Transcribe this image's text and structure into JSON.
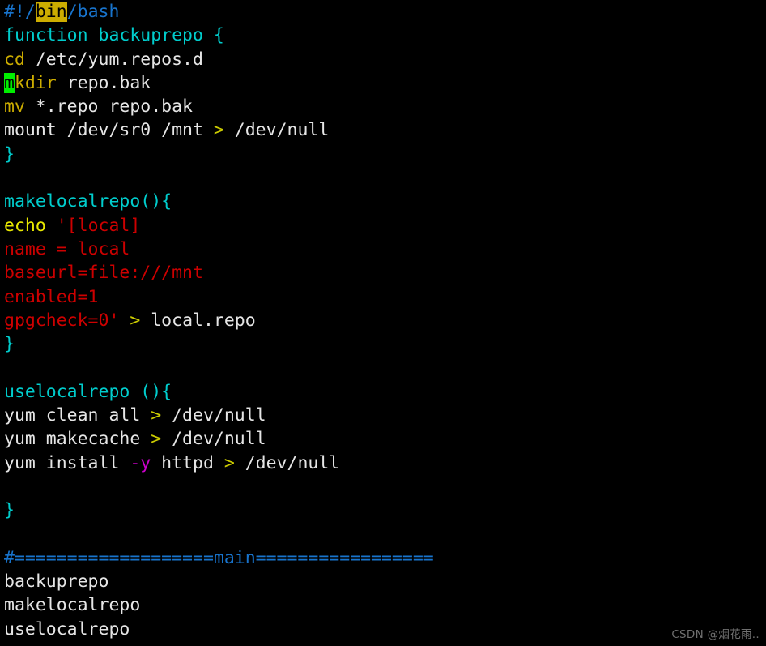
{
  "editor": {
    "background_color": "#000000",
    "default_text_color": "#d9d9d9",
    "font_size_px": 21.5,
    "line_height_px": 29.3,
    "search_highlight_color": "#cdad00",
    "cursor_color": "#00ee00",
    "palette": {
      "comment_blue": "#1874cd",
      "keyword_cyan": "#00cdcd",
      "command_olive": "#cdad00",
      "echo_yellow": "#e8e800",
      "redirect_gold": "#cdcd00",
      "string_red": "#cd0000",
      "flag_magenta": "#cd00cd",
      "plain_white": "#e6e6e6"
    },
    "lines": [
      {
        "id": "line-1",
        "text": "#!/bin/bash",
        "tokens": [
          {
            "t": "#!/",
            "c": "c-blue"
          },
          {
            "t": "bin",
            "c": "c-blue",
            "hl": "search"
          },
          {
            "t": "/bash",
            "c": "c-blue"
          }
        ]
      },
      {
        "id": "line-2",
        "text": "function backuprepo {",
        "tokens": [
          {
            "t": "function backuprepo {",
            "c": "c-cyan"
          }
        ]
      },
      {
        "id": "line-3",
        "text": "cd /etc/yum.repos.d",
        "tokens": [
          {
            "t": "cd",
            "c": "c-olive"
          },
          {
            "t": " /etc/yum.repos.d",
            "c": "c-white"
          }
        ]
      },
      {
        "id": "line-4",
        "text": "mkdir repo.bak",
        "tokens": [
          {
            "t": "m",
            "c": "c-olive",
            "hl": "cursor"
          },
          {
            "t": "kdir",
            "c": "c-olive"
          },
          {
            "t": " repo.bak",
            "c": "c-white"
          }
        ]
      },
      {
        "id": "line-5",
        "text": "mv *.repo repo.bak",
        "tokens": [
          {
            "t": "mv",
            "c": "c-olive"
          },
          {
            "t": " *.repo repo.bak",
            "c": "c-white"
          }
        ]
      },
      {
        "id": "line-6",
        "text": "mount /dev/sr0 /mnt > /dev/null",
        "tokens": [
          {
            "t": "mount /dev/sr0 /mnt ",
            "c": "c-white"
          },
          {
            "t": ">",
            "c": "c-gold"
          },
          {
            "t": " /dev/null",
            "c": "c-white"
          }
        ]
      },
      {
        "id": "line-7",
        "text": "}",
        "tokens": [
          {
            "t": "}",
            "c": "c-cyan"
          }
        ]
      },
      {
        "id": "line-8",
        "text": "",
        "tokens": []
      },
      {
        "id": "line-9",
        "text": "makelocalrepo(){",
        "tokens": [
          {
            "t": "makelocalrepo(){",
            "c": "c-cyan"
          }
        ]
      },
      {
        "id": "line-10",
        "text": "echo '[local]",
        "tokens": [
          {
            "t": "echo",
            "c": "c-yellow"
          },
          {
            "t": " ",
            "c": "c-white"
          },
          {
            "t": "'[local]",
            "c": "c-red"
          }
        ]
      },
      {
        "id": "line-11",
        "text": "name = local",
        "tokens": [
          {
            "t": "name = local",
            "c": "c-red"
          }
        ]
      },
      {
        "id": "line-12",
        "text": "baseurl=file:///mnt",
        "tokens": [
          {
            "t": "baseurl=file:///mnt",
            "c": "c-red"
          }
        ]
      },
      {
        "id": "line-13",
        "text": "enabled=1",
        "tokens": [
          {
            "t": "enabled=1",
            "c": "c-red"
          }
        ]
      },
      {
        "id": "line-14",
        "text": "gpgcheck=0' > local.repo",
        "tokens": [
          {
            "t": "gpgcheck=0'",
            "c": "c-red"
          },
          {
            "t": " ",
            "c": "c-white"
          },
          {
            "t": ">",
            "c": "c-gold"
          },
          {
            "t": " local.repo",
            "c": "c-white"
          }
        ]
      },
      {
        "id": "line-15",
        "text": "}",
        "tokens": [
          {
            "t": "}",
            "c": "c-cyan"
          }
        ]
      },
      {
        "id": "line-16",
        "text": "",
        "tokens": []
      },
      {
        "id": "line-17",
        "text": "uselocalrepo (){",
        "tokens": [
          {
            "t": "uselocalrepo (){",
            "c": "c-cyan"
          }
        ]
      },
      {
        "id": "line-18",
        "text": "yum clean all > /dev/null",
        "tokens": [
          {
            "t": "yum clean all ",
            "c": "c-white"
          },
          {
            "t": ">",
            "c": "c-gold"
          },
          {
            "t": " /dev/null",
            "c": "c-white"
          }
        ]
      },
      {
        "id": "line-19",
        "text": "yum makecache > /dev/null",
        "tokens": [
          {
            "t": "yum makecache ",
            "c": "c-white"
          },
          {
            "t": ">",
            "c": "c-gold"
          },
          {
            "t": " /dev/null",
            "c": "c-white"
          }
        ]
      },
      {
        "id": "line-20",
        "text": "yum install -y httpd > /dev/null",
        "tokens": [
          {
            "t": "yum install ",
            "c": "c-white"
          },
          {
            "t": "-y",
            "c": "c-magenta"
          },
          {
            "t": " httpd ",
            "c": "c-white"
          },
          {
            "t": ">",
            "c": "c-gold"
          },
          {
            "t": " /dev/null",
            "c": "c-white"
          }
        ]
      },
      {
        "id": "line-21",
        "text": "",
        "tokens": []
      },
      {
        "id": "line-22",
        "text": "}",
        "tokens": [
          {
            "t": "}",
            "c": "c-cyan"
          }
        ]
      },
      {
        "id": "line-23",
        "text": "",
        "tokens": []
      },
      {
        "id": "line-24",
        "text": "#===================main====================",
        "tokens": [
          {
            "t": "#===================main=================",
            "c": "c-blue"
          }
        ]
      },
      {
        "id": "line-25",
        "text": "backuprepo",
        "tokens": [
          {
            "t": "backuprepo",
            "c": "c-white"
          }
        ]
      },
      {
        "id": "line-26",
        "text": "makelocalrepo",
        "tokens": [
          {
            "t": "makelocalrepo",
            "c": "c-white"
          }
        ]
      },
      {
        "id": "line-27",
        "text": "uselocalrepo",
        "tokens": [
          {
            "t": "uselocalrepo",
            "c": "c-white"
          }
        ]
      }
    ]
  },
  "watermark": {
    "text": "CSDN @烟花雨.."
  }
}
